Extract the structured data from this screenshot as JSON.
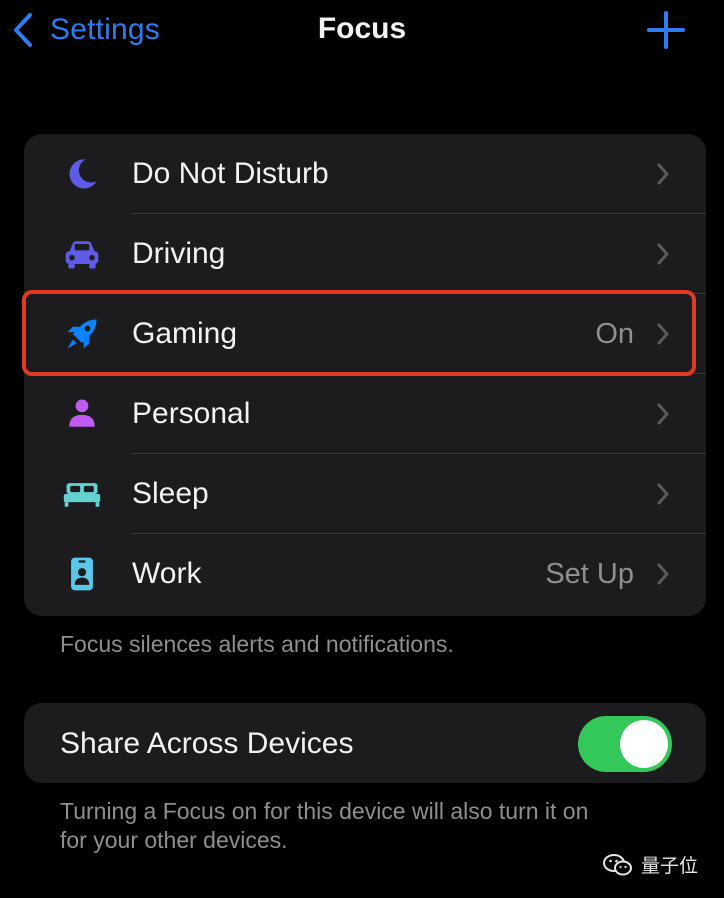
{
  "nav": {
    "back_label": "Settings",
    "title": "Focus",
    "accent": "#2f7bf0"
  },
  "focus_list": {
    "items": [
      {
        "label": "Do Not Disturb",
        "value": "",
        "icon": "moon-icon",
        "color": "#5e5ce6"
      },
      {
        "label": "Driving",
        "value": "",
        "icon": "car-icon",
        "color": "#5e5ce6"
      },
      {
        "label": "Gaming",
        "value": "On",
        "icon": "rocket-icon",
        "color": "#0a84ff",
        "highlighted": true
      },
      {
        "label": "Personal",
        "value": "",
        "icon": "person-icon",
        "color": "#bf5af2"
      },
      {
        "label": "Sleep",
        "value": "",
        "icon": "bed-icon",
        "color": "#64d2d0"
      },
      {
        "label": "Work",
        "value": "Set Up",
        "icon": "id-badge-icon",
        "color": "#5ac8e8"
      }
    ],
    "footer": "Focus silences alerts and notifications."
  },
  "share": {
    "label": "Share Across Devices",
    "enabled": true,
    "toggle_color": "#34c759",
    "footer_line1": "Turning a Focus on for this device will also turn it on",
    "footer_line2": "for your other devices."
  },
  "watermark": {
    "text": "量子位",
    "icon": "wechat-icon"
  }
}
